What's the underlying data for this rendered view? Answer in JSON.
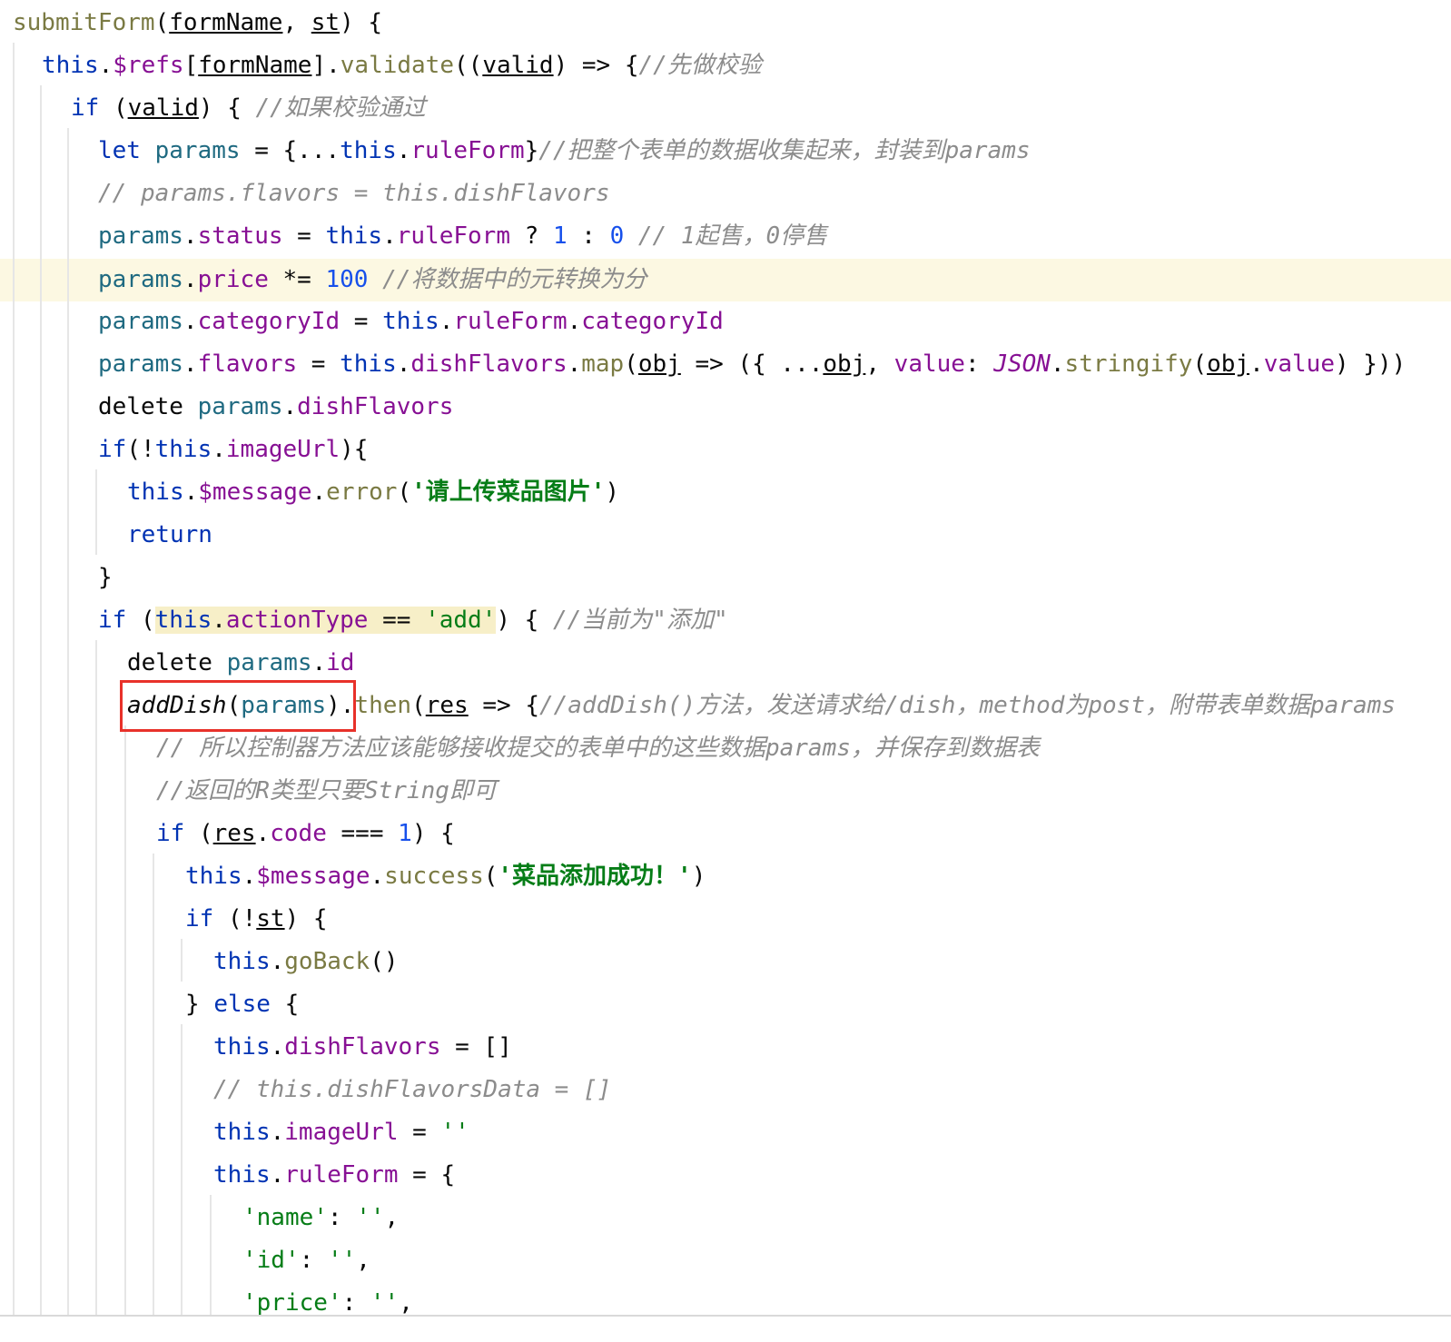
{
  "lines": [
    [
      "submitForm",
      "(",
      "formName",
      ", ",
      "st",
      ") {"
    ],
    [
      "this",
      ".",
      "$refs",
      "[",
      "formName",
      "].",
      "validate",
      "((",
      "valid",
      ") => {",
      "//先做校验"
    ],
    [
      "if",
      " (",
      "valid",
      ") { ",
      "//如果校验通过"
    ],
    [
      "let",
      " ",
      "params",
      " = {...",
      "this",
      ".",
      "ruleForm",
      "}",
      "//把整个表单的数据收集起来，封装到params"
    ],
    [
      "// params.flavors = this.dishFlavors"
    ],
    [
      "params",
      ".",
      "status",
      " = ",
      "this",
      ".",
      "ruleForm",
      " ? ",
      "1",
      " : ",
      "0",
      " ",
      "// 1起售，0停售"
    ],
    [
      "params",
      ".",
      "price",
      " *= ",
      "100",
      " ",
      "//将数据中的元转换为分"
    ],
    [
      "params",
      ".",
      "categoryId",
      " = ",
      "this",
      ".",
      "ruleForm",
      ".",
      "categoryId"
    ],
    [
      "params",
      ".",
      "flavors",
      " = ",
      "this",
      ".",
      "dishFlavors",
      ".",
      "map",
      "(",
      "obj",
      " => ({ ...",
      "obj",
      ", ",
      "value",
      ": ",
      "JSON",
      ".",
      "stringify",
      "(",
      "obj",
      ".",
      "value",
      ") }))"
    ],
    [
      "delete",
      " ",
      "params",
      ".",
      "dishFlavors"
    ],
    [
      "if",
      "(!",
      "this",
      ".",
      "imageUrl",
      "){"
    ],
    [
      "this",
      ".",
      "$message",
      ".",
      "error",
      "(",
      "'请上传菜品图片'",
      ")"
    ],
    [
      "return"
    ],
    [
      "}"
    ],
    [
      "if",
      " (",
      "this",
      ".",
      "actionType",
      " == ",
      "'add'",
      ") { ",
      "//当前为\"添加\""
    ],
    [
      "delete",
      " ",
      "params",
      ".",
      "id"
    ],
    [
      "addDish",
      "(",
      "params",
      ").",
      "then",
      "(",
      "res",
      " => {",
      "//addDish()方法，发送请求给/dish，method为post，附带表单数据params"
    ],
    [
      "// 所以控制器方法应该能够接收提交的表单中的这些数据params，并保存到数据表"
    ],
    [
      "//返回的R类型只要String即可"
    ],
    [
      "if",
      " (",
      "res",
      ".",
      "code",
      " === ",
      "1",
      ") {"
    ],
    [
      "this",
      ".",
      "$message",
      ".",
      "success",
      "(",
      "'菜品添加成功！'",
      ")"
    ],
    [
      "if",
      " (!",
      "st",
      ") {"
    ],
    [
      "this",
      ".",
      "goBack",
      "()"
    ],
    [
      "} ",
      "else",
      " {"
    ],
    [
      "this",
      ".",
      "dishFlavors",
      " = []"
    ],
    [
      "// this.dishFlavorsData = []"
    ],
    [
      "this",
      ".",
      "imageUrl",
      " = ",
      "''"
    ],
    [
      "this",
      ".",
      "ruleForm",
      " = {"
    ],
    [
      "'name'",
      ": ",
      "''",
      ","
    ],
    [
      "'id'",
      ": ",
      "''",
      ","
    ],
    [
      "'price'",
      ": ",
      "''",
      ","
    ]
  ]
}
